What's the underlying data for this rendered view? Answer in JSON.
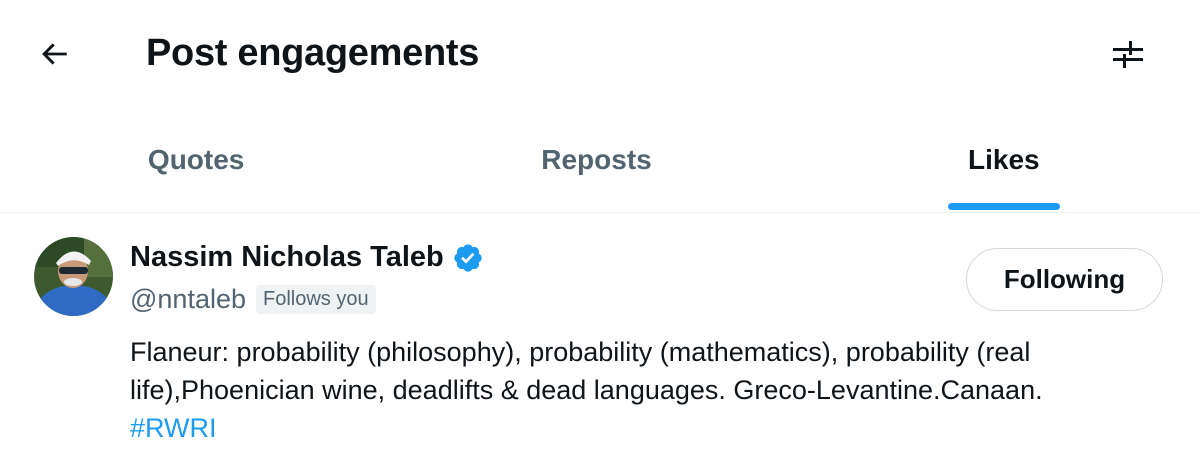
{
  "header": {
    "title": "Post engagements",
    "back_icon": "arrow-left-icon",
    "filter_icon": "sliders-icon"
  },
  "tabs": [
    {
      "label": "Quotes",
      "active": false
    },
    {
      "label": "Reposts",
      "active": false
    },
    {
      "label": "Likes",
      "active": true
    }
  ],
  "user": {
    "name": "Nassim Nicholas Taleb",
    "verified": true,
    "handle": "@nntaleb",
    "follows_you": "Follows you",
    "follow_button": "Following",
    "bio_text": "Flaneur: probability (philosophy), probability (mathematics), probability (real life),Phoenician wine, deadlifts & dead languages. Greco-Levantine.Canaan. ",
    "bio_hashtag": "#RWRI"
  },
  "colors": {
    "accent": "#1d9bf0",
    "text_primary": "#0f1419",
    "text_secondary": "#536471",
    "border": "#eff3f4"
  }
}
